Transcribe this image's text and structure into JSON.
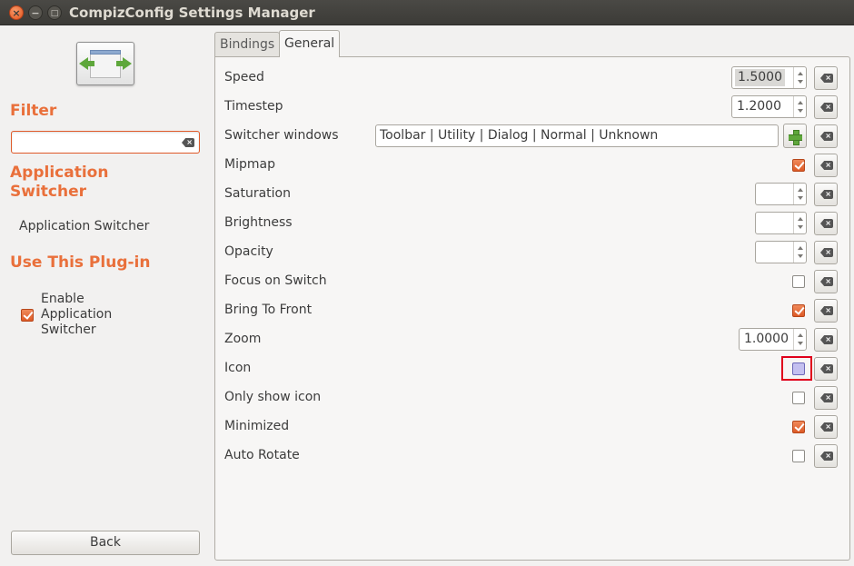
{
  "window": {
    "title": "CompizConfig Settings Manager",
    "buttons": {
      "close": "×",
      "minimize": "−",
      "maximize": "□"
    }
  },
  "sidebar": {
    "plugin_icon": "application-switcher-icon",
    "filter_heading": "Filter",
    "filter_value": "",
    "category_heading_line1": "Application",
    "category_heading_line2": "Switcher",
    "category_item": "Application Switcher",
    "use_heading": "Use This Plug-in",
    "enable_label_line1": "Enable",
    "enable_label_line2": "Application",
    "enable_label_line3": "Switcher",
    "enable_checked": true,
    "back_label": "Back"
  },
  "tabs": [
    {
      "label": "Bindings",
      "active": false
    },
    {
      "label": "General",
      "active": true
    }
  ],
  "settings": {
    "speed": {
      "label": "Speed",
      "value": "1.5000"
    },
    "timestep": {
      "label": "Timestep",
      "value": "1.2000"
    },
    "switcher_windows": {
      "label": "Switcher windows",
      "value": "Toolbar | Utility | Dialog | Normal | Unknown"
    },
    "mipmap": {
      "label": "Mipmap",
      "checked": true
    },
    "saturation": {
      "label": "Saturation",
      "value": ""
    },
    "brightness": {
      "label": "Brightness",
      "value": ""
    },
    "opacity": {
      "label": "Opacity",
      "value": ""
    },
    "focus_on_switch": {
      "label": "Focus on Switch",
      "checked": false
    },
    "bring_to_front": {
      "label": "Bring To Front",
      "checked": true
    },
    "zoom": {
      "label": "Zoom",
      "value": "1.0000"
    },
    "icon": {
      "label": "Icon",
      "checked": false
    },
    "only_show_icon": {
      "label": "Only show icon",
      "checked": false
    },
    "minimized": {
      "label": "Minimized",
      "checked": true
    },
    "auto_rotate": {
      "label": "Auto Rotate",
      "checked": false
    }
  },
  "colors": {
    "accent": "#e9703b",
    "highlight": "#e0001b"
  },
  "icons": {
    "reset": "clear-icon",
    "add": "plus-icon"
  }
}
